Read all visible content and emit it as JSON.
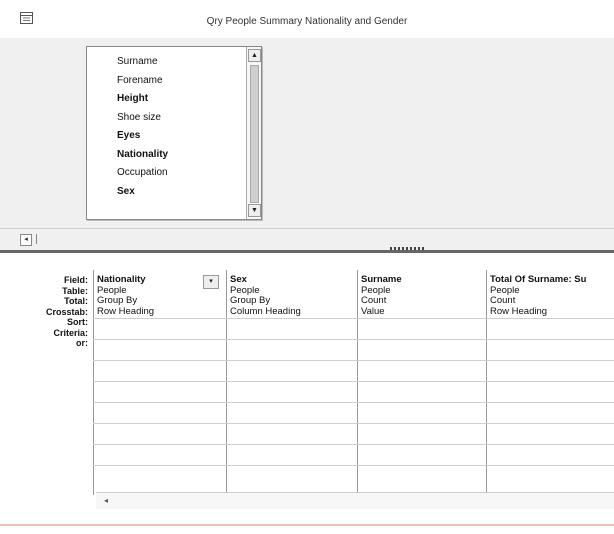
{
  "window": {
    "title": "Qry People Summary Nationality and Gender",
    "icon": "query-design-icon"
  },
  "table_box": {
    "fields": [
      {
        "label": "Surname",
        "bold": false
      },
      {
        "label": "Forename",
        "bold": false
      },
      {
        "label": "Height",
        "bold": true
      },
      {
        "label": "Shoe size",
        "bold": false
      },
      {
        "label": "Eyes",
        "bold": true
      },
      {
        "label": "Nationality",
        "bold": true
      },
      {
        "label": "Occupation",
        "bold": false
      },
      {
        "label": "Sex",
        "bold": true
      }
    ]
  },
  "grid": {
    "row_labels": [
      "Field:",
      "Table:",
      "Total:",
      "Crosstab:",
      "Sort:",
      "Criteria:",
      "or:"
    ],
    "columns": [
      {
        "field": "Nationality",
        "table": "People",
        "total": "Group By",
        "crosstab": "Row Heading"
      },
      {
        "field": "Sex",
        "table": "People",
        "total": "Group By",
        "crosstab": "Column Heading"
      },
      {
        "field": "Surname",
        "table": "People",
        "total": "Count",
        "crosstab": "Value"
      },
      {
        "field": "Total Of Surname: Su",
        "table": "People",
        "total": "Count",
        "crosstab": "Row Heading"
      }
    ]
  }
}
